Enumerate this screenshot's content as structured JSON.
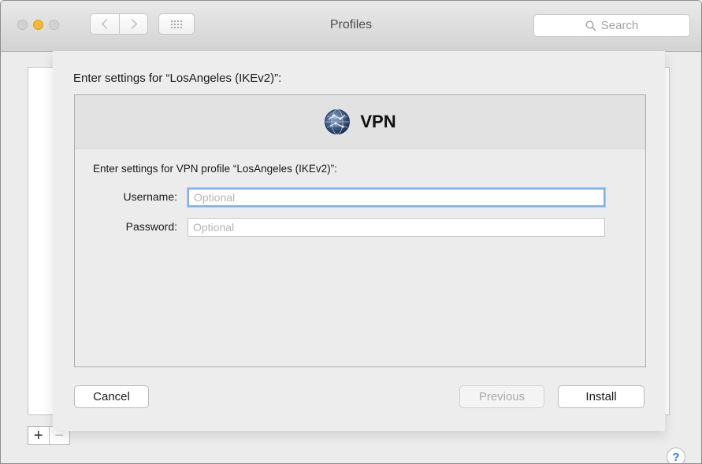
{
  "window": {
    "title": "Profiles",
    "search": {
      "placeholder": "Search"
    }
  },
  "toolbar": {
    "back_label": "Back",
    "forward_label": "Forward",
    "show_all_label": "Show All"
  },
  "colors": {
    "accent_focus": "#7fb0ee",
    "minimize_light": "#f5b82e",
    "help_blue": "#2b7cf5"
  },
  "sheet": {
    "heading": "Enter settings for “LosAngeles (IKEv2)”:",
    "box": {
      "icon": "globe-network-icon",
      "title": "VPN",
      "description": "Enter settings for VPN profile “LosAngeles (IKEv2)”:",
      "fields": [
        {
          "label": "Username:",
          "value": "",
          "placeholder": "Optional"
        },
        {
          "label": "Password:",
          "value": "",
          "placeholder": "Optional"
        }
      ]
    },
    "buttons": {
      "cancel": "Cancel",
      "previous": "Previous",
      "install": "Install"
    }
  },
  "footer": {
    "add_symbol": "+",
    "remove_symbol": "−",
    "help_symbol": "?"
  }
}
